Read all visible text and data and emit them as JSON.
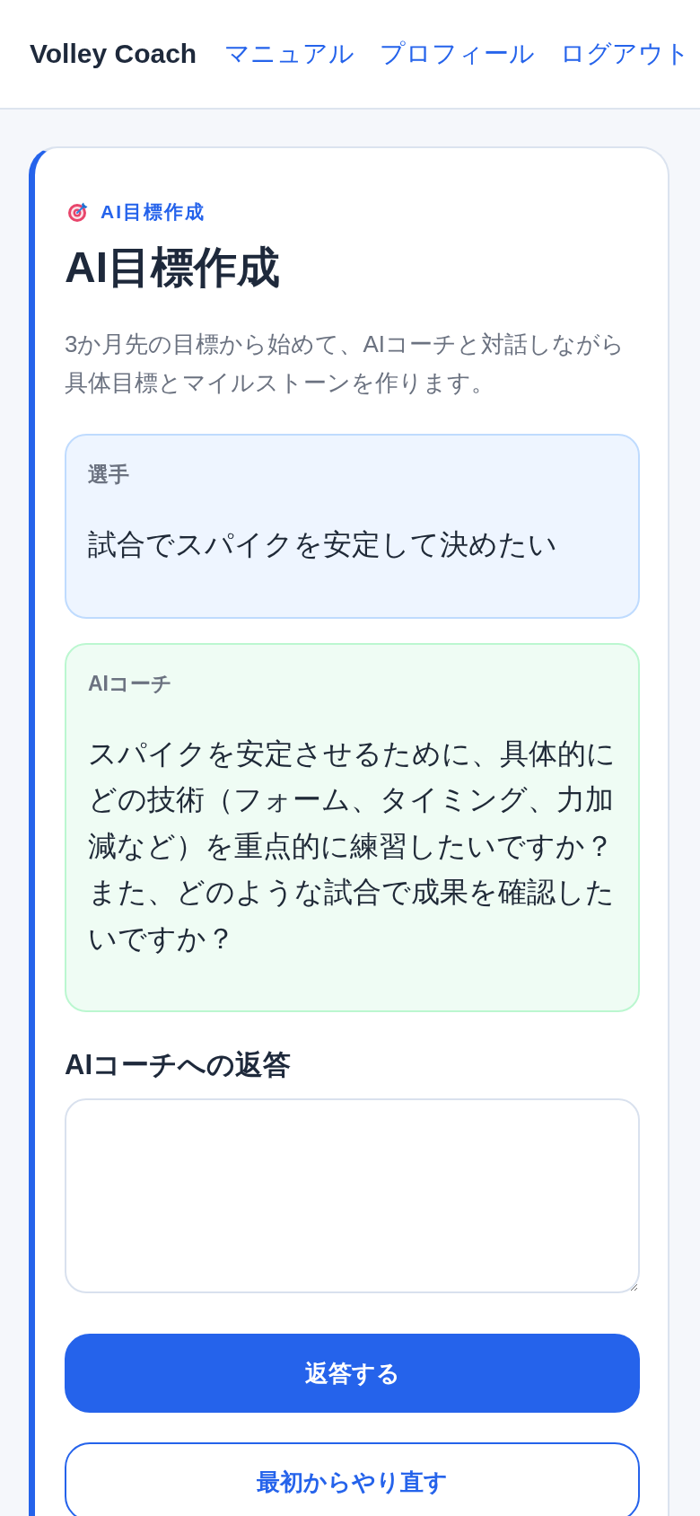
{
  "header": {
    "brand": "Volley Coach",
    "nav": [
      "マニュアル",
      "プロフィール",
      "ログアウト"
    ]
  },
  "card": {
    "eyebrow": "AI目標作成",
    "title": "AI目標作成",
    "description": "3か月先の目標から始めて、AIコーチと対話しながら具体目標とマイルストーンを作ります。",
    "messages": [
      {
        "kind": "player",
        "speaker": "選手",
        "text": "試合でスパイクを安定して決めたい"
      },
      {
        "kind": "coach",
        "speaker": "AIコーチ",
        "text": "スパイクを安定させるために、具体的にどの技術（フォーム、タイミング、力加減など）を重点的に練習したいですか？また、どのような試合で成果を確認したいですか？"
      }
    ],
    "reply": {
      "label": "AIコーチへの返答"
    },
    "buttons": [
      {
        "kind": "primary",
        "label": "返答する"
      },
      {
        "kind": "secondary",
        "label": "最初からやり直す"
      }
    ]
  }
}
